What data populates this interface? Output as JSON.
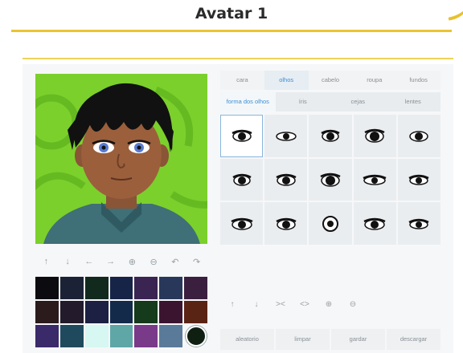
{
  "header": {
    "title": "Avatar 1"
  },
  "tabs": [
    {
      "label": "cara",
      "active": false
    },
    {
      "label": "olhos",
      "active": true
    },
    {
      "label": "cabelo",
      "active": false
    },
    {
      "label": "roupa",
      "active": false
    },
    {
      "label": "fundos",
      "active": false
    }
  ],
  "subtabs": [
    {
      "label": "forma dos olhos",
      "active": true
    },
    {
      "label": "íris",
      "active": false
    },
    {
      "label": "cejas",
      "active": false
    },
    {
      "label": "lentes",
      "active": false
    }
  ],
  "eye_grid": {
    "rows": 3,
    "cols": 5,
    "selected_index": 0
  },
  "left_toolbar": {
    "icons": [
      "arrow-up-icon",
      "arrow-down-icon",
      "arrow-left-icon",
      "arrow-right-icon",
      "zoom-in-icon",
      "zoom-out-icon",
      "undo-icon",
      "redo-icon"
    ],
    "glyphs": [
      "↑",
      "↓",
      "←",
      "→",
      "⊕",
      "⊖",
      "↶",
      "↷"
    ]
  },
  "right_toolbar": {
    "icons": [
      "arrow-up-icon",
      "arrow-down-icon",
      "compress-icon",
      "expand-icon",
      "zoom-in-icon",
      "zoom-out-icon"
    ],
    "glyphs": [
      "↑",
      "↓",
      "><",
      "<>",
      "⊕",
      "⊖"
    ]
  },
  "palette": {
    "colors": [
      "#0b0b10",
      "#1c2236",
      "#122a1e",
      "#162447",
      "#3a2452",
      "#28385a",
      "#3a1f3f",
      "#2b1b1c",
      "#231a2b",
      "#1c2042",
      "#142a4a",
      "#153a1c",
      "#3b1430",
      "#5a2414",
      "#3a2a6a",
      "#1f4a5e",
      "#d7f7f2",
      "#5fa7a7",
      "#7a3a8a",
      "#5a7a9a",
      "#0f1f12"
    ],
    "selected_index": 20
  },
  "actions": [
    {
      "label": "aleatorio"
    },
    {
      "label": "limpar"
    },
    {
      "label": "gardar"
    },
    {
      "label": "descargar"
    }
  ],
  "colors": {
    "accent": "#e9c531",
    "active_tab": "#3a8fd6",
    "avatar_bg": "#7bd02c"
  }
}
